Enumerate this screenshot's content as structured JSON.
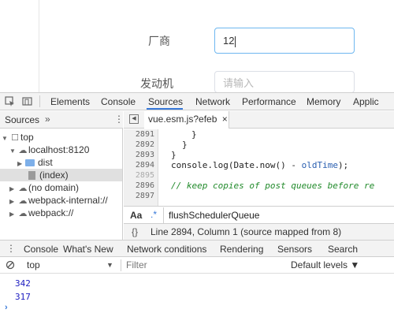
{
  "form": {
    "manufacturer_label": "厂商",
    "manufacturer_value": "12",
    "engine_label": "发动机",
    "engine_placeholder": "请输入"
  },
  "devtools": {
    "tabs": [
      "Elements",
      "Console",
      "Sources",
      "Network",
      "Performance",
      "Memory",
      "Applic"
    ],
    "active_tab": "Sources",
    "navigator": {
      "title": "Sources",
      "more": "»",
      "tree": [
        "top",
        "localhost:8120",
        "dist",
        "(index)",
        "(no domain)",
        "webpack-internal://",
        "webpack://"
      ]
    },
    "editor": {
      "file_tab": "vue.esm.js?efeb",
      "close": "×",
      "line_numbers": [
        "2891",
        "2892",
        "2893",
        "2894",
        "2895",
        "2896",
        "2897"
      ],
      "code_lines": {
        "l2891": "}",
        "l2892": "}",
        "l2893": "}",
        "l2894_a": "console.log(Date.now() - ",
        "l2894_b": "oldTime",
        "l2894_c": ");",
        "l2896": "// keep copies of post queues before re"
      },
      "search": {
        "case_label": "Aa",
        "regex_label": ".*",
        "query": "flushSchedulerQueue"
      },
      "status": {
        "brace": "{}",
        "text": "Line 2894, Column 1  (source mapped from 8)"
      }
    },
    "drawer": {
      "tabs": [
        "Console",
        "What's New",
        "Network conditions",
        "Rendering",
        "Sensors",
        "Search"
      ],
      "active": "Console",
      "context": "top",
      "filter_placeholder": "Filter",
      "levels": "Default levels ▼",
      "output": [
        "342",
        "317"
      ],
      "prompt": "›"
    }
  },
  "colors": {
    "accent": "#3879d9",
    "focus_border": "#6eb7f0",
    "console_number": "#1c1cc0",
    "comment": "#208a2a"
  }
}
